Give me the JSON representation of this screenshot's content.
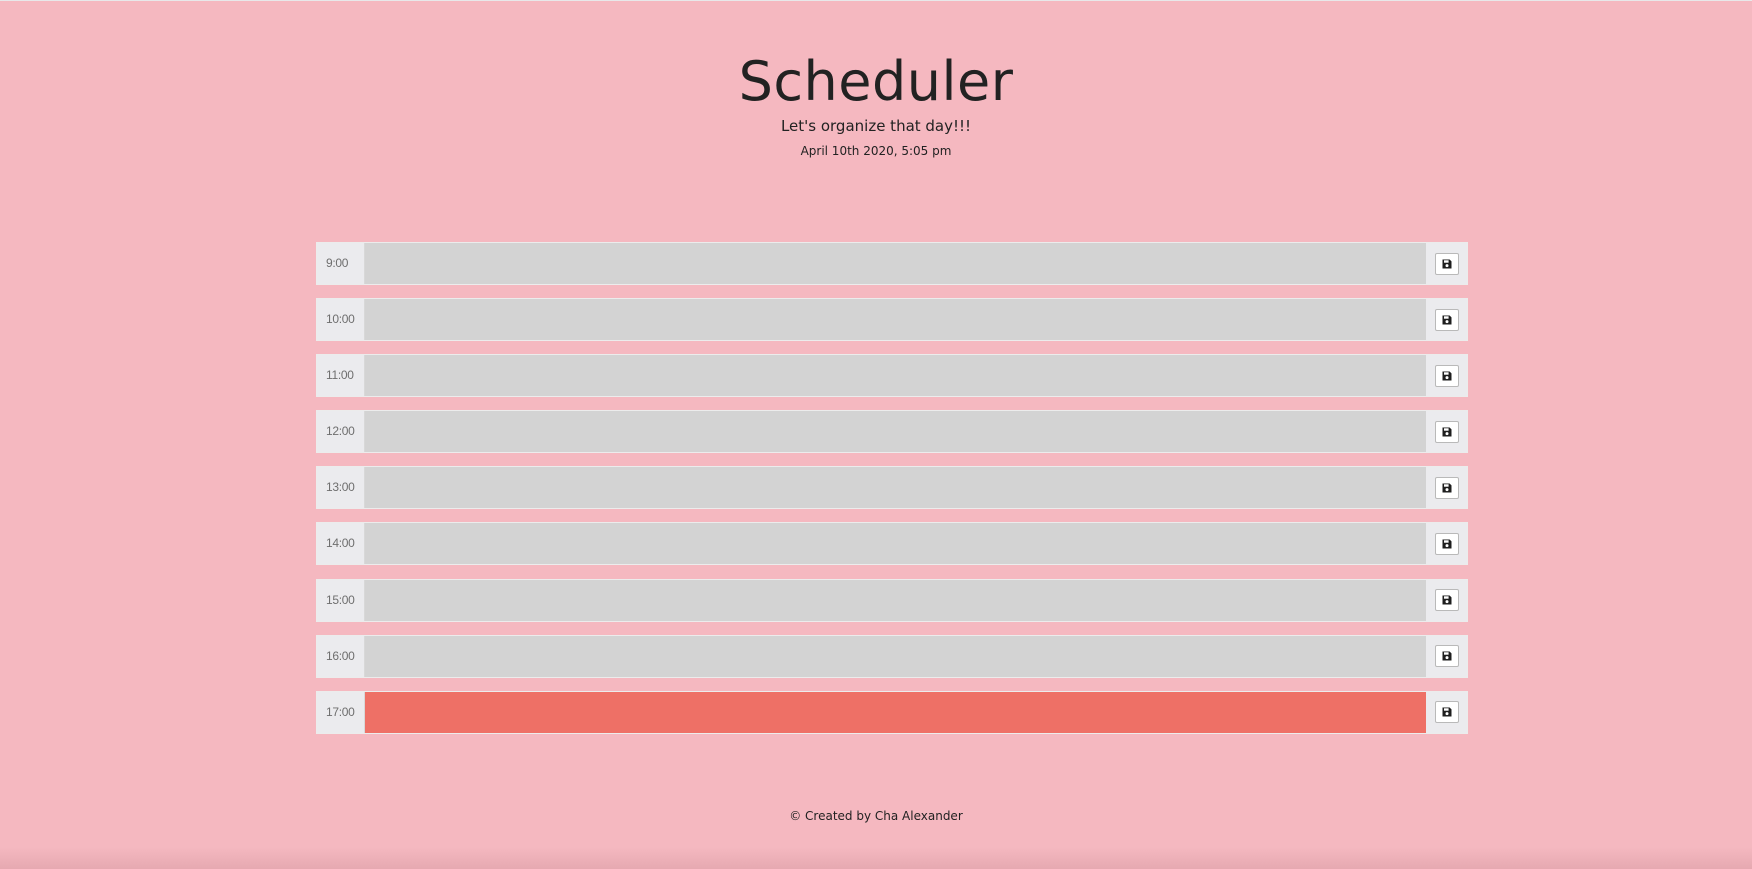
{
  "header": {
    "title": "Scheduler",
    "lead": "Let's organize that day!!!",
    "current_day": "April 10th 2020, 5:05 pm"
  },
  "time_blocks": [
    {
      "hour": "9:00",
      "text": "",
      "state": "past"
    },
    {
      "hour": "10:00",
      "text": "",
      "state": "past"
    },
    {
      "hour": "11:00",
      "text": "",
      "state": "past"
    },
    {
      "hour": "12:00",
      "text": "",
      "state": "past"
    },
    {
      "hour": "13:00",
      "text": "",
      "state": "past"
    },
    {
      "hour": "14:00",
      "text": "",
      "state": "past"
    },
    {
      "hour": "15:00",
      "text": "",
      "state": "past"
    },
    {
      "hour": "16:00",
      "text": "",
      "state": "past"
    },
    {
      "hour": "17:00",
      "text": "",
      "state": "present"
    }
  ],
  "save_icon": "floppy-disk-icon",
  "footer": {
    "credit": "© Created by Cha Alexander"
  },
  "colors": {
    "page_background": "#f5b8c0",
    "past": "#d3d3d3",
    "present": "#ee7066"
  }
}
